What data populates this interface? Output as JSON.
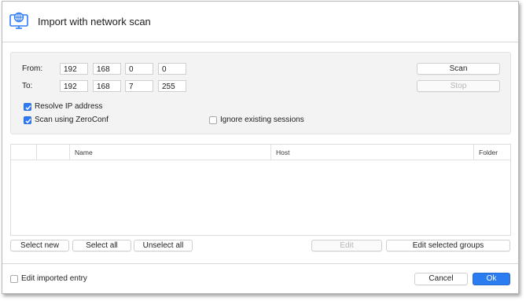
{
  "window": {
    "title": "Import with network scan",
    "icon": "monitor-network-icon"
  },
  "range": {
    "from_label": "From:",
    "to_label": "To:",
    "from": [
      "192",
      "168",
      "0",
      "0"
    ],
    "to": [
      "192",
      "168",
      "7",
      "255"
    ]
  },
  "actions": {
    "scan": "Scan",
    "stop": "Stop"
  },
  "options": {
    "resolve_ip": {
      "label": "Resolve IP address",
      "checked": true
    },
    "zeroconf": {
      "label": "Scan using ZeroConf",
      "checked": true
    },
    "ignore_existing": {
      "label": "Ignore existing sessions",
      "checked": false
    }
  },
  "table": {
    "columns": [
      "",
      "",
      "Name",
      "Host",
      "Folder"
    ],
    "rows": []
  },
  "selection": {
    "select_new": "Select new",
    "select_all": "Select all",
    "unselect_all": "Unselect all",
    "edit": "Edit",
    "edit_groups": "Edit selected groups"
  },
  "footer": {
    "edit_imported": {
      "label": "Edit imported entry",
      "checked": false
    },
    "cancel": "Cancel",
    "ok": "Ok"
  },
  "colors": {
    "accent": "#2b7cf0",
    "title_icon": "#2f7bf6"
  }
}
